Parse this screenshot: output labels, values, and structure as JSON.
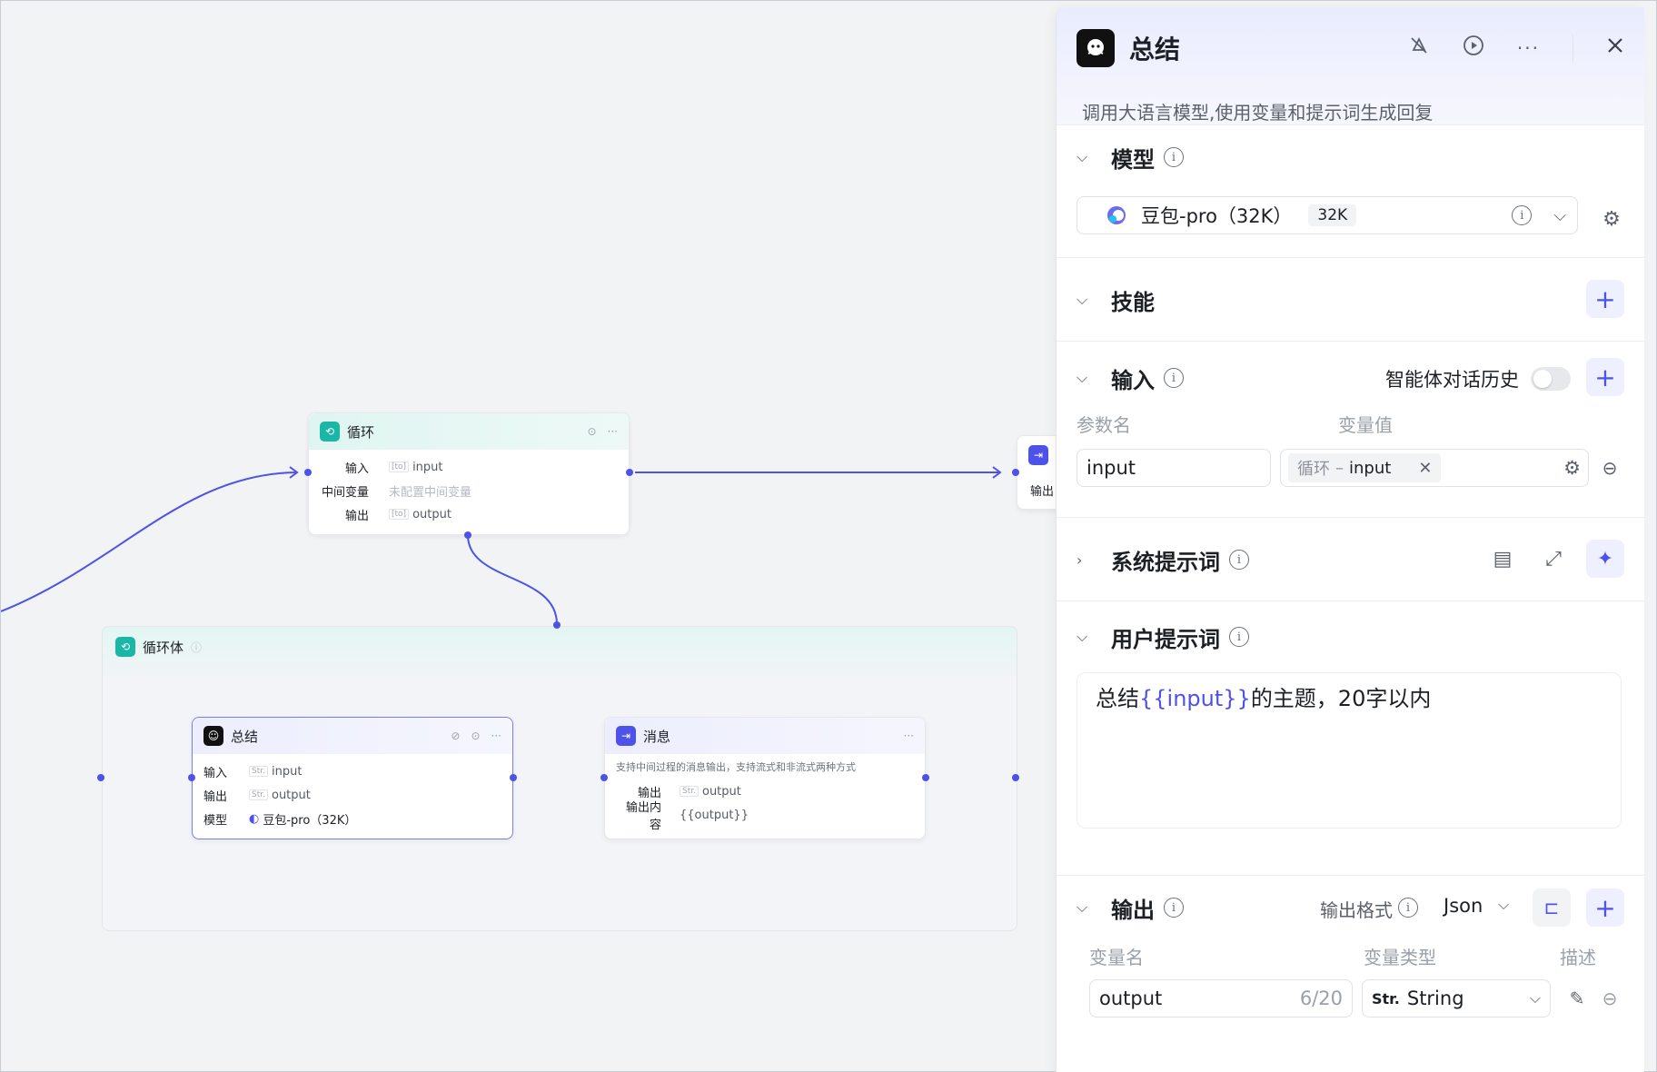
{
  "canvas": {
    "loop_node": {
      "title": "循环",
      "rows": [
        {
          "key": "输入",
          "value": "input",
          "tag": "[to]"
        },
        {
          "key": "中间变量",
          "value": "未配置中间变量"
        },
        {
          "key": "输出",
          "value": "output",
          "tag": "[to]"
        }
      ]
    },
    "end_node_label": "输出",
    "loop_body": {
      "title": "循环体"
    },
    "summary_node": {
      "title": "总结",
      "rows": [
        {
          "key": "输入",
          "value": "input",
          "tag": "Str."
        },
        {
          "key": "输出",
          "value": "output",
          "tag": "Str."
        },
        {
          "key": "模型",
          "value": "豆包-pro（32K）"
        }
      ]
    },
    "message_node": {
      "title": "消息",
      "description": "支持中间过程的消息输出，支持流式和非流式两种方式",
      "rows": [
        {
          "key": "输出",
          "value": "output",
          "tag": "Str."
        },
        {
          "key": "输出内容",
          "value": "{{output}}"
        }
      ]
    }
  },
  "panel": {
    "title": "总结",
    "description": "调用大语言模型,使用变量和提示词生成回复",
    "model_section": {
      "title": "模型",
      "model_name": "豆包-pro（32K）",
      "badge": "32K"
    },
    "skills_section": {
      "title": "技能"
    },
    "input_section": {
      "title": "输入",
      "history_label": "智能体对话历史",
      "col_param": "参数名",
      "col_value": "变量值",
      "param_value": "input",
      "var_source": "循环",
      "var_sep": "–",
      "var_name": "input"
    },
    "system_prompt": {
      "title": "系统提示词"
    },
    "user_prompt": {
      "title": "用户提示词",
      "text_before": "总结",
      "variable": "{{input}}",
      "text_after": "的主题，20字以内"
    },
    "output_section": {
      "title": "输出",
      "format_label": "输出格式",
      "format_value": "Json",
      "col_name": "变量名",
      "col_type": "变量类型",
      "col_desc": "描述",
      "var_name": "output",
      "counter": "6/20",
      "type_tag": "Str.",
      "type_name": "String"
    }
  },
  "colors": {
    "accent": "#4d53e8",
    "loop_teal": "#1ab7a6"
  }
}
